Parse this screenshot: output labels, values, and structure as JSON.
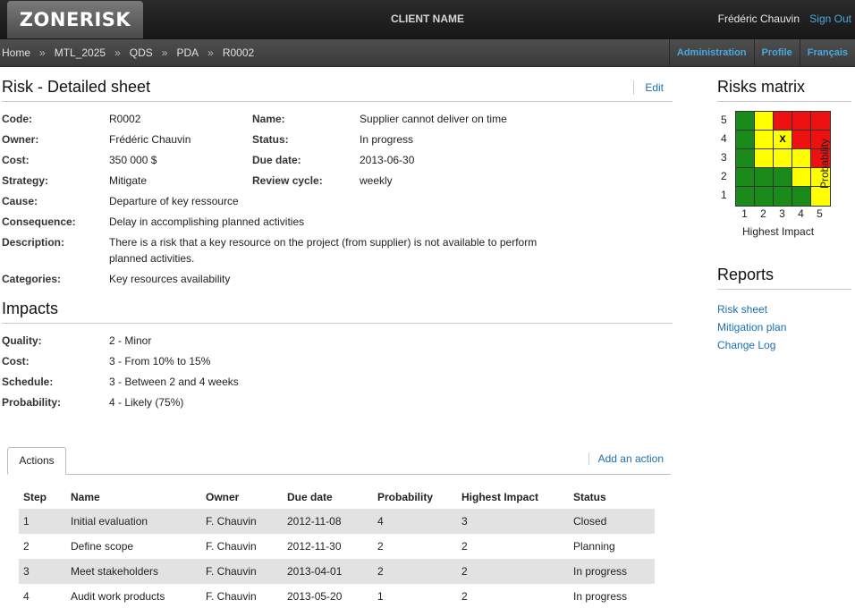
{
  "header": {
    "logo": "ZONERISK",
    "client_name": "CLIENT NAME",
    "user_name": "Frédéric Chauvin",
    "sign_out": "Sign Out"
  },
  "breadcrumb": [
    "Home",
    "MTL_2025",
    "QDS",
    "PDA",
    "R0002"
  ],
  "breadcrumb_separator": "»",
  "user_nav": [
    "Administration",
    "Profile",
    "Français"
  ],
  "risk": {
    "title": "Risk - Detailed sheet",
    "edit_label": "Edit",
    "labels": {
      "code": "Code:",
      "owner": "Owner:",
      "cost": "Cost:",
      "strategy": "Strategy:",
      "cause": "Cause:",
      "consequence": "Consequence:",
      "description": "Description:",
      "categories": "Categories:",
      "name": "Name:",
      "status": "Status:",
      "due_date": "Due date:",
      "review_cycle": "Review cycle:"
    },
    "code": "R0002",
    "owner": "Frédéric Chauvin",
    "cost": "350 000 $",
    "strategy": "Mitigate",
    "cause": "Departure of key ressource",
    "consequence": "Delay in accomplishing planned activities",
    "description": "There is a risk that a key resource on the project (from supplier) is not available to perform planned activities.",
    "categories": "Key resources availability",
    "name": "Supplier cannot deliver on time",
    "status": "In progress",
    "due_date": "2013-06-30",
    "review_cycle": "weekly"
  },
  "impacts": {
    "title": "Impacts",
    "labels": {
      "quality": "Quality:",
      "cost": "Cost:",
      "schedule": "Schedule:",
      "probability": "Probability:"
    },
    "quality": "2 - Minor",
    "cost": "3 - From 10% to 15%",
    "schedule": "3 - Between 2 and 4 weeks",
    "probability": "4 - Likely (75%)"
  },
  "actions": {
    "tab_label": "Actions",
    "add_label": "Add an action",
    "columns": [
      "Step",
      "Name",
      "Owner",
      "Due date",
      "Probability",
      "Highest Impact",
      "Status"
    ],
    "rows": [
      [
        "1",
        "Initial evaluation",
        "F. Chauvin",
        "2012-11-08",
        "4",
        "3",
        "Closed"
      ],
      [
        "2",
        "Define scope",
        "F. Chauvin",
        "2012-11-30",
        "2",
        "2",
        "Planning"
      ],
      [
        "3",
        "Meet stakeholders",
        "F. Chauvin",
        "2013-04-01",
        "2",
        "2",
        "In progress"
      ],
      [
        "4",
        "Audit work products",
        "F. Chauvin",
        "2013-05-20",
        "1",
        "2",
        "In progress"
      ]
    ]
  },
  "matrix": {
    "title": "Risks matrix",
    "x_title": "Highest Impact",
    "y_title": "Probability",
    "x_ticks": [
      "1",
      "2",
      "3",
      "4",
      "5"
    ],
    "y_ticks": [
      "5",
      "4",
      "3",
      "2",
      "1"
    ],
    "colors": {
      "G": "#1a8a1a",
      "Y": "#ffff00",
      "R": "#ee1111"
    },
    "grid": [
      [
        "G",
        "Y",
        "R",
        "R",
        "R"
      ],
      [
        "G",
        "Y",
        "Y",
        "R",
        "R"
      ],
      [
        "G",
        "Y",
        "Y",
        "Y",
        "R"
      ],
      [
        "G",
        "G",
        "G",
        "Y",
        "Y"
      ],
      [
        "G",
        "G",
        "G",
        "G",
        "Y"
      ]
    ],
    "marker": {
      "text": "X",
      "probability": 4,
      "impact": 3
    }
  },
  "reports": {
    "title": "Reports",
    "links": [
      "Risk sheet",
      "Mitigation plan",
      "Change Log"
    ]
  }
}
